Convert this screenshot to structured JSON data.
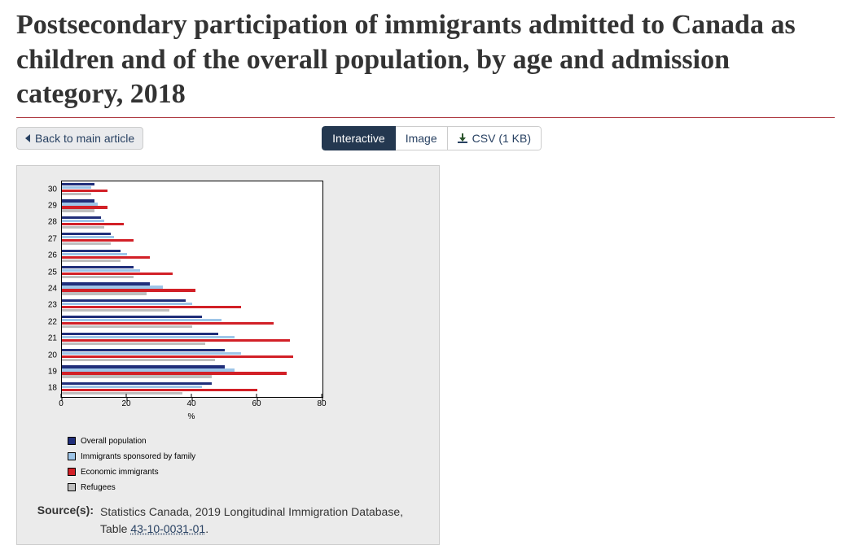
{
  "title": "Postsecondary participation of immigrants admitted to Canada as children and of the overall population, by age and admission category, 2018",
  "toolbar": {
    "back_label": "Back to main article",
    "tab_interactive": "Interactive",
    "tab_image": "Image",
    "tab_csv": "CSV (1 KB)"
  },
  "legend": {
    "overall": "Overall population",
    "family": "Immigrants sponsored by family",
    "econ": "Economic immigrants",
    "ref": "Refugees"
  },
  "axis": {
    "x_title": "%",
    "x_ticks": [
      "0",
      "20",
      "40",
      "60",
      "80"
    ]
  },
  "source": {
    "label": "Source(s):",
    "text_before": "Statistics Canada, 2019 Longitudinal Immigration Database, Table ",
    "link_text": "43-10-0031-01",
    "text_after": "."
  },
  "chart_data": {
    "type": "bar",
    "orientation": "horizontal",
    "xlabel": "%",
    "ylabel": "",
    "xlim": [
      0,
      80
    ],
    "categories": [
      "30",
      "29",
      "28",
      "27",
      "26",
      "25",
      "24",
      "23",
      "22",
      "21",
      "20",
      "19",
      "18"
    ],
    "series": [
      {
        "name": "Overall population",
        "color": "#202e7a",
        "values": [
          10,
          10,
          12,
          15,
          18,
          22,
          27,
          38,
          43,
          48,
          50,
          50,
          46
        ]
      },
      {
        "name": "Immigrants sponsored by family",
        "color": "#9ec5e8",
        "values": [
          9,
          11,
          13,
          16,
          20,
          24,
          31,
          40,
          49,
          53,
          55,
          53,
          43
        ]
      },
      {
        "name": "Economic immigrants",
        "color": "#d22027",
        "values": [
          14,
          14,
          19,
          22,
          27,
          34,
          41,
          55,
          65,
          70,
          71,
          69,
          60
        ]
      },
      {
        "name": "Refugees",
        "color": "#bfbfbf",
        "values": [
          9,
          10,
          13,
          15,
          18,
          22,
          26,
          33,
          40,
          44,
          47,
          46,
          37
        ]
      }
    ]
  }
}
